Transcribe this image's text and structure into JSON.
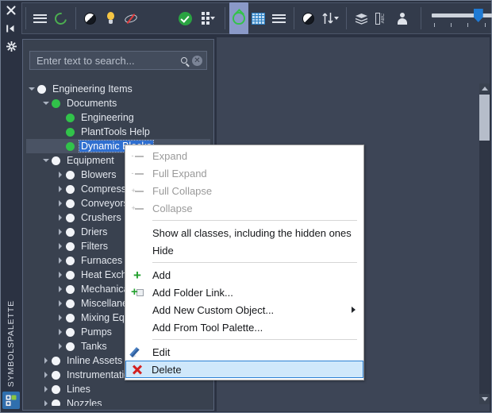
{
  "window": {
    "background": "#2b3242",
    "accent": "#2f6fd0"
  },
  "rail": {
    "label": "SYMBOLSPALETTE",
    "icons": [
      {
        "name": "close-icon",
        "glyph": "✖"
      },
      {
        "name": "auto-hide-icon",
        "glyph": "▶|"
      },
      {
        "name": "settings-icon",
        "glyph": "⚙"
      }
    ],
    "bottom_icon": "symbol-palette-icon"
  },
  "toolbar": {
    "groups": [
      {
        "name": "view-group",
        "items": [
          {
            "name": "menu-lines-icon",
            "label": "Menu",
            "type": "lines",
            "active": false
          },
          {
            "name": "refresh-icon",
            "label": "Refresh",
            "type": "refresh",
            "active": false
          }
        ]
      },
      {
        "name": "display-group",
        "items": [
          {
            "name": "shading-icon",
            "label": "Shading",
            "type": "halfcircle",
            "active": false
          },
          {
            "name": "lightbulb-icon",
            "label": "Light",
            "type": "bulb",
            "active": false
          },
          {
            "name": "hide-view-icon",
            "label": "Hide",
            "type": "noshow",
            "active": false
          }
        ]
      },
      {
        "name": "validate-group",
        "items": [
          {
            "name": "check-icon",
            "label": "Validate",
            "type": "check",
            "active": false
          },
          {
            "name": "grid-dots-icon",
            "label": "Options",
            "type": "dots",
            "active": false,
            "has_caret": true
          }
        ]
      },
      {
        "name": "palette-mode-group",
        "items": [
          {
            "name": "symbol-view-icon",
            "label": "Symbol View",
            "type": "drop",
            "active": true
          },
          {
            "name": "table-view-icon",
            "label": "Table View",
            "type": "table",
            "active": false
          },
          {
            "name": "list-view-icon",
            "label": "List View",
            "type": "lines",
            "active": false
          }
        ]
      },
      {
        "name": "sort-group",
        "items": [
          {
            "name": "contrast-icon",
            "label": "Contrast",
            "type": "halfcircle",
            "active": false
          },
          {
            "name": "sort-icon",
            "label": "Sort",
            "type": "sort",
            "active": false,
            "has_caret": true
          }
        ]
      },
      {
        "name": "object-group",
        "items": [
          {
            "name": "layers-icon",
            "label": "Layers",
            "type": "layers",
            "active": false
          },
          {
            "name": "annotation-icon",
            "label": "Annotation",
            "type": "abc",
            "active": false,
            "text": "ABC"
          },
          {
            "name": "user-icon",
            "label": "User",
            "type": "person",
            "active": false
          }
        ]
      }
    ],
    "slider": {
      "name": "size-slider",
      "value": 48,
      "min": 0,
      "max": 100,
      "tick_count": 6
    }
  },
  "search": {
    "name": "search-input",
    "placeholder": "Enter text to search...",
    "value": "",
    "search_icon": "search-icon",
    "clear_icon": "clear-icon",
    "clear_glyph": "✕"
  },
  "tree": {
    "nodes": [
      {
        "label": "Engineering Items",
        "depth": 0,
        "expander": "down",
        "bullet": "white",
        "selected": false
      },
      {
        "label": "Documents",
        "depth": 1,
        "expander": "down",
        "bullet": "green",
        "selected": false
      },
      {
        "label": "Engineering",
        "depth": 2,
        "expander": "none",
        "bullet": "green",
        "selected": false
      },
      {
        "label": "PlantTools Help",
        "depth": 2,
        "expander": "none",
        "bullet": "green",
        "selected": false
      },
      {
        "label": "Dynamic Blocks",
        "depth": 2,
        "expander": "none",
        "bullet": "green",
        "selected": true
      },
      {
        "label": "Equipment",
        "depth": 1,
        "expander": "down",
        "bullet": "white",
        "selected": false
      },
      {
        "label": "Blowers",
        "depth": 2,
        "expander": "right",
        "bullet": "white",
        "selected": false
      },
      {
        "label": "Compressors",
        "depth": 2,
        "expander": "right",
        "bullet": "white",
        "selected": false
      },
      {
        "label": "Conveyors",
        "depth": 2,
        "expander": "right",
        "bullet": "white",
        "selected": false
      },
      {
        "label": "Crushers",
        "depth": 2,
        "expander": "right",
        "bullet": "white",
        "selected": false
      },
      {
        "label": "Driers",
        "depth": 2,
        "expander": "right",
        "bullet": "white",
        "selected": false
      },
      {
        "label": "Filters",
        "depth": 2,
        "expander": "right",
        "bullet": "white",
        "selected": false
      },
      {
        "label": "Furnaces",
        "depth": 2,
        "expander": "right",
        "bullet": "white",
        "selected": false
      },
      {
        "label": "Heat Exchangers",
        "depth": 2,
        "expander": "right",
        "bullet": "white",
        "selected": false
      },
      {
        "label": "Mechanical",
        "depth": 2,
        "expander": "right",
        "bullet": "white",
        "selected": false
      },
      {
        "label": "Miscellaneous",
        "depth": 2,
        "expander": "right",
        "bullet": "white",
        "selected": false
      },
      {
        "label": "Mixing Equipment",
        "depth": 2,
        "expander": "right",
        "bullet": "white",
        "selected": false
      },
      {
        "label": "Pumps",
        "depth": 2,
        "expander": "right",
        "bullet": "white",
        "selected": false
      },
      {
        "label": "Tanks",
        "depth": 2,
        "expander": "right",
        "bullet": "white",
        "selected": false
      },
      {
        "label": "Inline Assets",
        "depth": 1,
        "expander": "right",
        "bullet": "white",
        "selected": false
      },
      {
        "label": "Instrumentation",
        "depth": 1,
        "expander": "right",
        "bullet": "white",
        "selected": false
      },
      {
        "label": "Lines",
        "depth": 1,
        "expander": "right",
        "bullet": "white",
        "selected": false
      },
      {
        "label": "Nozzles",
        "depth": 1,
        "expander": "right",
        "bullet": "white",
        "selected": false
      }
    ],
    "scrollbar": {
      "name": "tree-scrollbar",
      "up_icon": "scroll-up-icon",
      "down_icon": "scroll-down-icon"
    }
  },
  "context_menu": {
    "items": [
      {
        "label": "Expand",
        "icon": "expand-icon",
        "disabled": true,
        "selected": false,
        "submenu": false,
        "separator_after": false
      },
      {
        "label": "Full Expand",
        "icon": "full-expand-icon",
        "disabled": true,
        "selected": false,
        "submenu": false,
        "separator_after": false
      },
      {
        "label": "Full Collapse",
        "icon": "full-collapse-icon",
        "disabled": true,
        "selected": false,
        "submenu": false,
        "separator_after": false
      },
      {
        "label": "Collapse",
        "icon": "collapse-icon",
        "disabled": true,
        "selected": false,
        "submenu": false,
        "separator_after": true
      },
      {
        "label": "Show all classes, including the hidden ones",
        "icon": "none",
        "disabled": false,
        "selected": false,
        "submenu": false,
        "separator_after": false
      },
      {
        "label": "Hide",
        "icon": "none",
        "disabled": false,
        "selected": false,
        "submenu": false,
        "separator_after": true
      },
      {
        "label": "Add",
        "icon": "plus-icon",
        "disabled": false,
        "selected": false,
        "submenu": false,
        "separator_after": false
      },
      {
        "label": "Add Folder Link...",
        "icon": "folder-plus-icon",
        "disabled": false,
        "selected": false,
        "submenu": false,
        "separator_after": false
      },
      {
        "label": "Add New Custom Object...",
        "icon": "none",
        "disabled": false,
        "selected": false,
        "submenu": true,
        "separator_after": false
      },
      {
        "label": "Add From Tool Palette...",
        "icon": "none",
        "disabled": false,
        "selected": false,
        "submenu": false,
        "separator_after": true
      },
      {
        "label": "Edit",
        "icon": "pencil-icon",
        "disabled": false,
        "selected": false,
        "submenu": false,
        "separator_after": false
      },
      {
        "label": "Delete",
        "icon": "delete-x-icon",
        "disabled": false,
        "selected": true,
        "submenu": false,
        "separator_after": false
      }
    ]
  }
}
